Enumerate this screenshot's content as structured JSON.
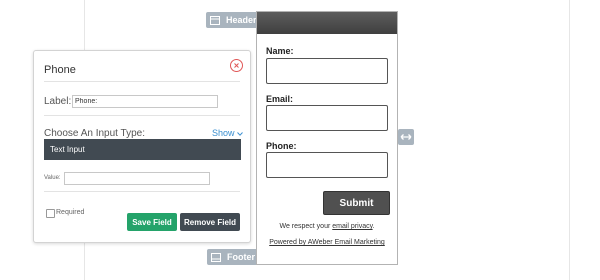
{
  "canvas": {
    "header_tag": "Header",
    "footer_tag": "Footer",
    "icons": [
      "header-layout-icon",
      "footer-layout-icon",
      "horizontal-resize-icon"
    ]
  },
  "form_preview": {
    "fields": [
      {
        "label": "Name:"
      },
      {
        "label": "Email:"
      },
      {
        "label": "Phone:"
      }
    ],
    "submit_label": "Submit",
    "privacy_prefix": "We respect your ",
    "privacy_link": "email privacy",
    "privacy_suffix": ".",
    "powered_by": "Powered by AWeber Email Marketing"
  },
  "panel": {
    "title": "Phone",
    "label_caption": "Label:",
    "label_value": "Phone:",
    "input_type_caption": "Choose An Input Type:",
    "show_link": "Show",
    "selected_type": "Text Input",
    "value_caption": "Value:",
    "value_value": "",
    "required_label": "Required",
    "required_checked": false,
    "save_button": "Save Field",
    "remove_button": "Remove Field"
  },
  "colors": {
    "save": "#24a36a",
    "dark": "#414a52",
    "link": "#3a8fd0",
    "close": "#e05757"
  }
}
